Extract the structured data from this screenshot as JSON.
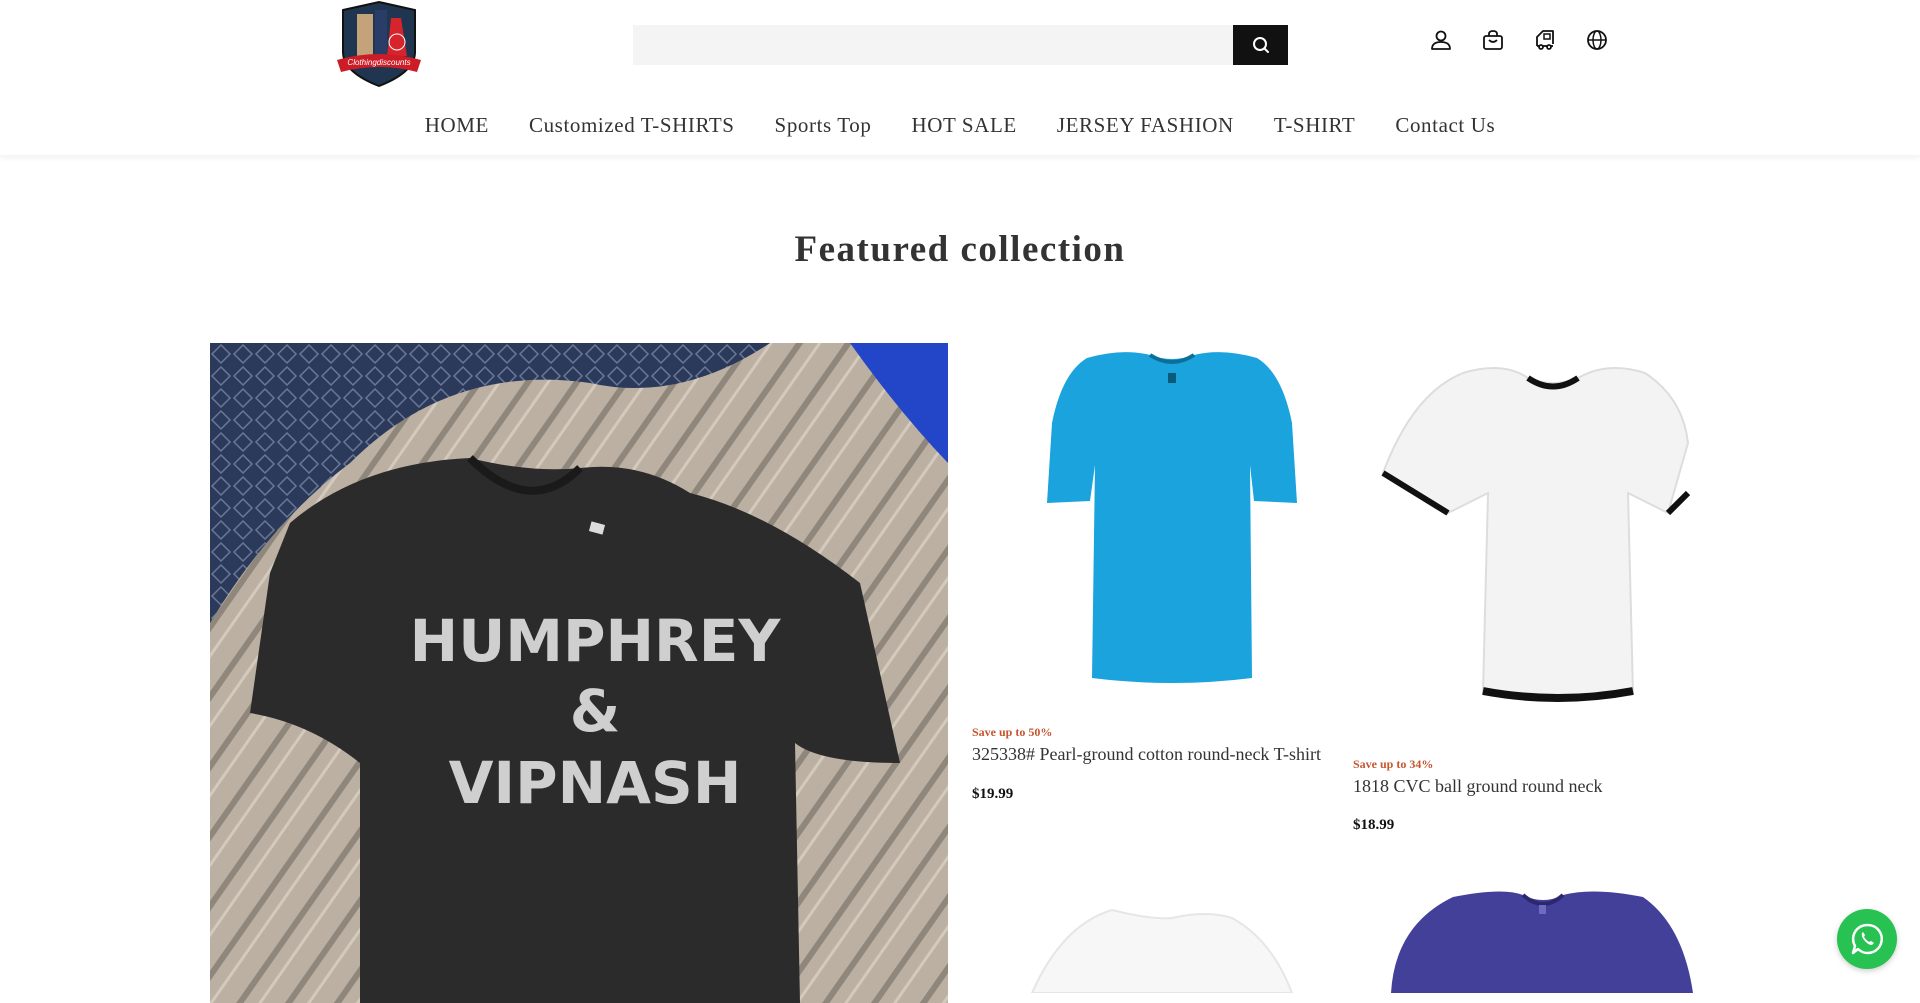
{
  "header": {
    "logo_text": "Clothingdiscounts",
    "search": {
      "placeholder": "",
      "value": ""
    },
    "icons": [
      "account-icon",
      "bag-icon",
      "order-tracking-icon",
      "language-icon"
    ]
  },
  "nav": {
    "items": [
      "HOME",
      "Customized T-SHIRTS",
      "Sports Top",
      "HOT SALE",
      "JERSEY FASHION",
      "T-SHIRT",
      "Contact Us"
    ]
  },
  "main": {
    "title": "Featured collection",
    "featured": {
      "shirt_text": [
        "HUMPHREY",
        "&",
        "VIPNASH"
      ]
    },
    "products": [
      {
        "save": "Save up to 50%",
        "name": "325338# Pearl-ground cotton round-neck T-shirt",
        "price": "$19.99",
        "color": "#1aa3dd"
      },
      {
        "save": "Save up to 34%",
        "name": "1818 CVC ball ground round neck",
        "price": "$18.99",
        "color": "#ffffff"
      }
    ]
  },
  "colors": {
    "sale": "#c6552f",
    "whatsapp": "#27c251",
    "search_button": "#111111"
  }
}
